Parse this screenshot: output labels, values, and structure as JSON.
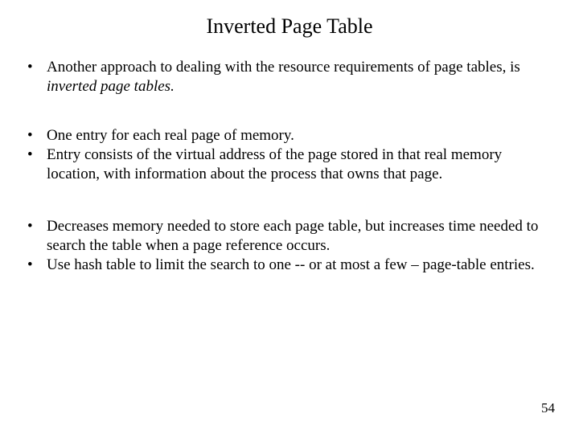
{
  "title": "Inverted Page Table",
  "bullets": {
    "b1_pre": "Another approach to dealing with the resource requirements of page tables, is ",
    "b1_em": "inverted page tables.",
    "b2": "One entry for each real page of memory.",
    "b3": "Entry consists of the virtual address of the page stored in that real memory location, with information about the process that owns that page.",
    "b4": "Decreases memory needed to store each page table, but increases time needed to search the table when a page reference occurs.",
    "b5": "Use hash table to limit the search to one -- or at most a few – page-table entries."
  },
  "page_number": "54"
}
